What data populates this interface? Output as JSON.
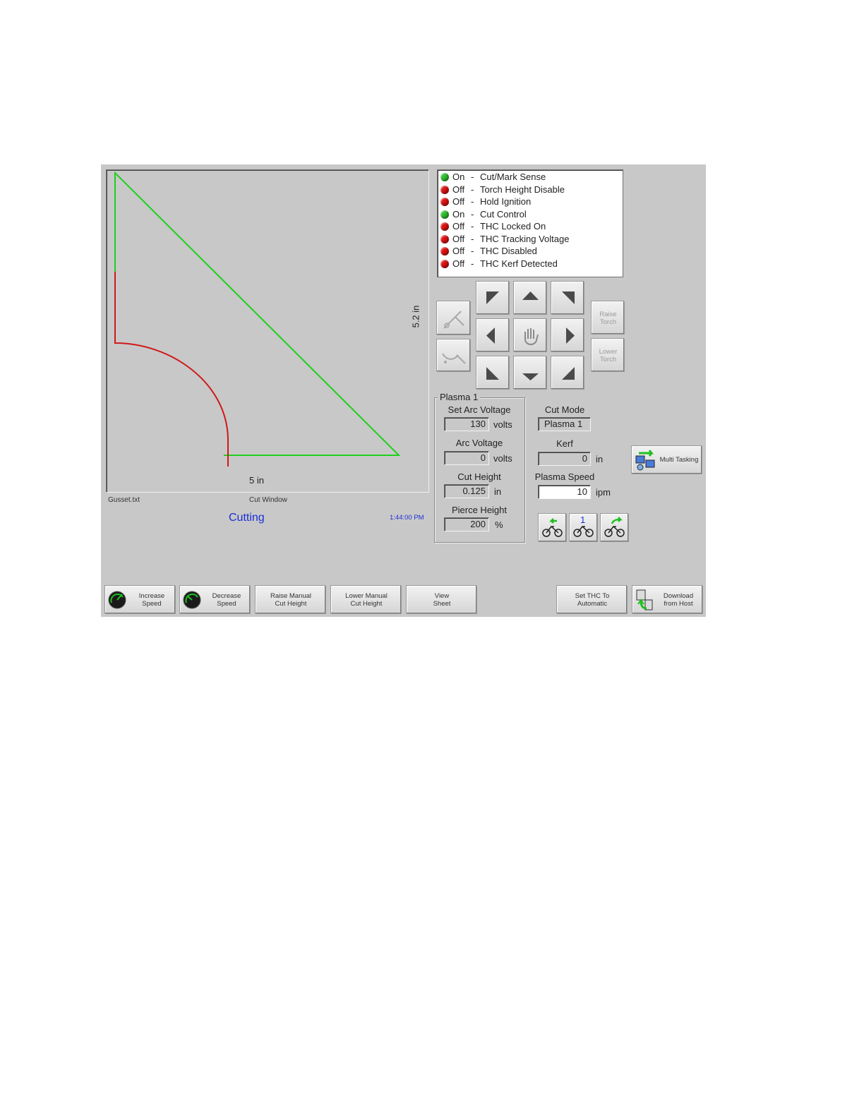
{
  "cut_window": {
    "file_name": "Gusset.txt",
    "title": "Cut Window",
    "status": "Cutting",
    "time": "1:44:00 PM",
    "dim_x": "5 in",
    "dim_y": "5.2 in"
  },
  "status_list": [
    {
      "state": "On",
      "label": "Cut/Mark Sense",
      "color": "#2ec02e"
    },
    {
      "state": "Off",
      "label": "Torch Height Disable",
      "color": "#e01010"
    },
    {
      "state": "Off",
      "label": "Hold Ignition",
      "color": "#e01010"
    },
    {
      "state": "On",
      "label": "Cut Control",
      "color": "#2ec02e"
    },
    {
      "state": "Off",
      "label": "THC Locked On",
      "color": "#e01010"
    },
    {
      "state": "Off",
      "label": "THC Tracking Voltage",
      "color": "#e01010"
    },
    {
      "state": "Off",
      "label": "THC Disabled",
      "color": "#e01010"
    },
    {
      "state": "Off",
      "label": "THC Kerf Detected",
      "color": "#e01010"
    }
  ],
  "jog": {
    "raise_torch": "Raise Torch",
    "lower_torch": "Lower Torch"
  },
  "plasma": {
    "group_label": "Plasma 1",
    "set_arc_voltage": {
      "label": "Set Arc Voltage",
      "value": "130",
      "unit": "volts"
    },
    "arc_voltage": {
      "label": "Arc Voltage",
      "value": "0",
      "unit": "volts"
    },
    "cut_height": {
      "label": "Cut Height",
      "value": "0.125",
      "unit": "in"
    },
    "pierce_height": {
      "label": "Pierce Height",
      "value": "200",
      "unit": "%"
    }
  },
  "cut_mode": {
    "label": "Cut Mode",
    "value": "Plasma 1"
  },
  "kerf": {
    "label": "Kerf",
    "value": "0",
    "unit": "in"
  },
  "plasma_speed": {
    "label": "Plasma Speed",
    "value": "10",
    "unit": "ipm"
  },
  "multitasking_label": "Multi Tasking",
  "speed_step_value": "1",
  "softkeys": {
    "increase_speed": [
      "Increase",
      "Speed"
    ],
    "decrease_speed": [
      "Decrease",
      "Speed"
    ],
    "raise_manual": [
      "Raise Manual",
      "Cut Height"
    ],
    "lower_manual": [
      "Lower Manual",
      "Cut Height"
    ],
    "view_sheet": [
      "View",
      "Sheet"
    ],
    "set_thc": [
      "Set THC To",
      "Automatic"
    ],
    "download": [
      "Download",
      "from Host"
    ]
  },
  "colors": {
    "panel_bg": "#c8c8c8",
    "path_cut": "#d01818",
    "path_pending": "#1ed01e",
    "status_blue": "#1a2fd6"
  }
}
